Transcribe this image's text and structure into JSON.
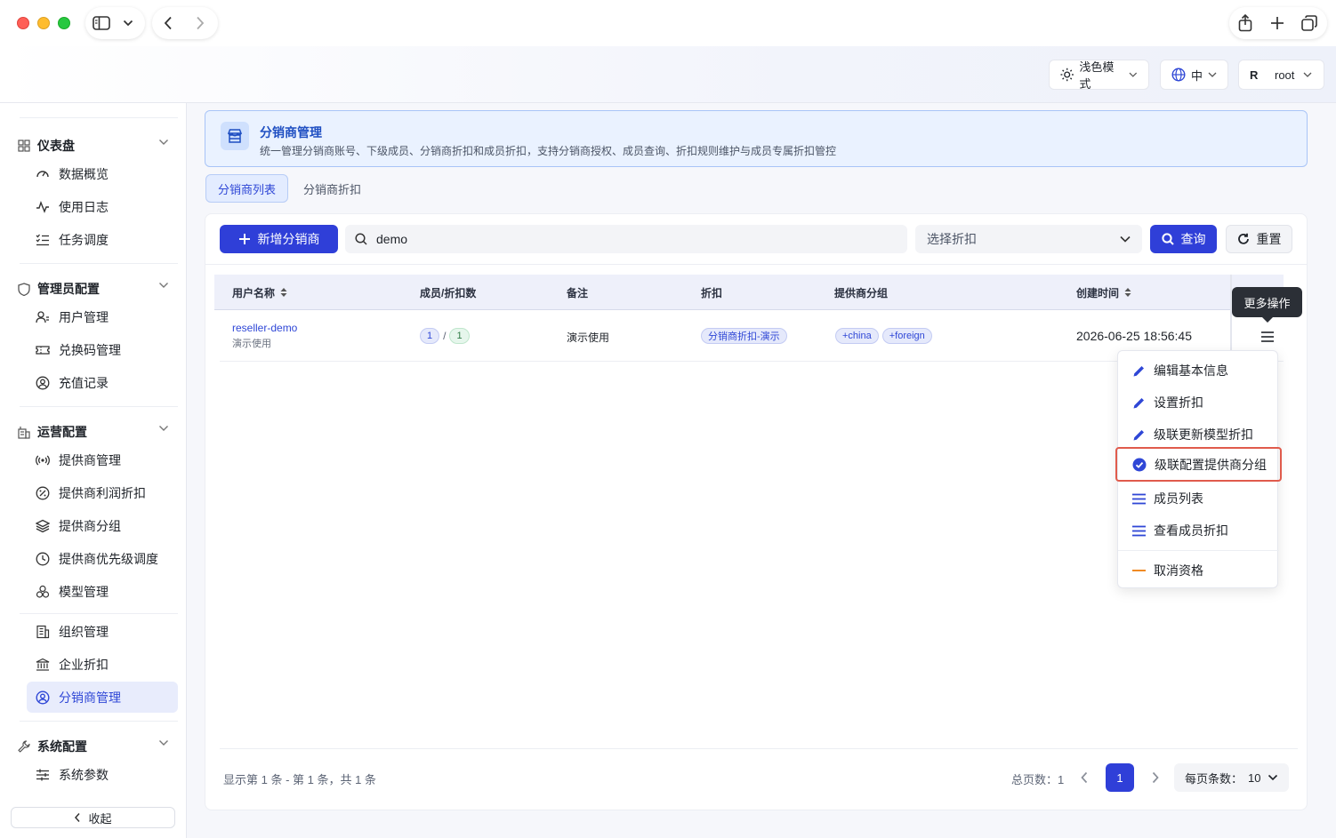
{
  "header": {
    "theme_label": "浅色模式",
    "lang_label": "中",
    "avatar_letter": "R",
    "user_label": "root"
  },
  "sidebar": {
    "groups": [
      {
        "label": "仪表盘",
        "icon": "grid-icon",
        "items": [
          {
            "label": "数据概览",
            "icon": "gauge-icon"
          },
          {
            "label": "使用日志",
            "icon": "activity-icon"
          },
          {
            "label": "任务调度",
            "icon": "checklist-icon"
          }
        ]
      },
      {
        "label": "管理员配置",
        "icon": "shield-icon",
        "items": [
          {
            "label": "用户管理",
            "icon": "user-icon"
          },
          {
            "label": "兑换码管理",
            "icon": "ticket-icon"
          },
          {
            "label": "充值记录",
            "icon": "user-circle-icon"
          }
        ]
      },
      {
        "label": "运营配置",
        "icon": "building-icon",
        "items": [
          {
            "label": "提供商管理",
            "icon": "broadcast-icon"
          },
          {
            "label": "提供商利润折扣",
            "icon": "percent-icon"
          },
          {
            "label": "提供商分组",
            "icon": "layers-icon"
          },
          {
            "label": "提供商优先级调度",
            "icon": "clock-icon"
          },
          {
            "label": "模型管理",
            "icon": "cubes-icon"
          },
          {
            "label": "组织管理",
            "icon": "office-icon"
          },
          {
            "label": "企业折扣",
            "icon": "bank-icon"
          },
          {
            "label": "分销商管理",
            "icon": "user-circle-icon"
          }
        ]
      },
      {
        "label": "系统配置",
        "icon": "wrench-icon",
        "items": [
          {
            "label": "系统参数",
            "icon": "sliders-icon"
          }
        ]
      }
    ],
    "collapse_label": "收起"
  },
  "banner": {
    "title": "分销商管理",
    "description": "统一管理分销商账号、下级成员、分销商折扣和成员折扣，支持分销商授权、成员查询、折扣规则维护与成员专属折扣管控"
  },
  "tabs": [
    "分销商列表",
    "分销商折扣"
  ],
  "toolbar": {
    "add_label": "新增分销商",
    "search_value": "demo",
    "discount_placeholder": "选择折扣",
    "query_label": "查询",
    "reset_label": "重置"
  },
  "table": {
    "columns": [
      "用户名称",
      "成员/折扣数",
      "备注",
      "折扣",
      "提供商分组",
      "创建时间"
    ],
    "rows": [
      {
        "username": "reseller-demo",
        "subtitle": "演示使用",
        "member_count": "1",
        "count_sep": "/",
        "discount_count": "1",
        "remark": "演示使用",
        "discount": "分销商折扣-演示",
        "groups": [
          "+china",
          "+foreign"
        ],
        "created_at": "2026-06-25 18:56:45"
      }
    ]
  },
  "more_tooltip": "更多操作",
  "menu": {
    "items": [
      {
        "label": "编辑基本信息",
        "icon": "pencil-icon"
      },
      {
        "label": "设置折扣",
        "icon": "pencil-icon"
      },
      {
        "label": "级联更新模型折扣",
        "icon": "pencil-icon"
      },
      {
        "label": "级联配置提供商分组",
        "icon": "check-circle-icon"
      },
      {
        "label": "成员列表",
        "icon": "list-icon"
      },
      {
        "label": "查看成员折扣",
        "icon": "list-icon"
      },
      {
        "label": "取消资格",
        "icon": "minus-icon"
      }
    ]
  },
  "pagination": {
    "info": "显示第 1 条 - 第 1 条，共 1 条",
    "total_pages_label": "总页数：",
    "total_pages": "1",
    "current_page": "1",
    "page_size_label": "每页条数：",
    "page_size": "10"
  },
  "colors": {
    "primary": "#2f3fd8",
    "banner_bg": "#eaf2ff",
    "highlight_border": "#e05b4c",
    "danger_icon": "#f08a24"
  }
}
